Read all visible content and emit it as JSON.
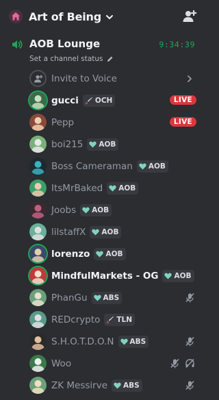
{
  "server": {
    "name": "Art of Being"
  },
  "channel": {
    "name": "AOB Lounge",
    "timer": "9:34:39",
    "status_placeholder": "Set a channel status"
  },
  "invite": {
    "label": "Invite to Voice"
  },
  "live_label": "LIVE",
  "members": [
    {
      "name": "gucci",
      "active": true,
      "tag": "OCH",
      "tag_icon": "sword-icon",
      "live": true,
      "avatar_bg": "#3a6b4a",
      "avatar_fg": "#c8e0c0"
    },
    {
      "name": "Pepp",
      "active": false,
      "tag": "",
      "tag_icon": "",
      "live": true,
      "avatar_bg": "#8a4a3a",
      "avatar_fg": "#f0d0b0"
    },
    {
      "name": "boi215",
      "active": false,
      "tag": "AOB",
      "tag_icon": "heart-icon",
      "live": false,
      "avatar_bg": "#7ab07a",
      "avatar_fg": "#e8e8e8"
    },
    {
      "name": "Boss Cameraman",
      "active": false,
      "tag": "AOB",
      "tag_icon": "heart-icon",
      "live": false,
      "avatar_bg": "#1c2a30",
      "avatar_fg": "#3ab0c0"
    },
    {
      "name": "ItsMrBaked",
      "active": false,
      "tag": "AOB",
      "tag_icon": "heart-icon",
      "live": false,
      "avatar_bg": "#3aa06a",
      "avatar_fg": "#f0c8b0"
    },
    {
      "name": "Joobs",
      "active": false,
      "tag": "AOB",
      "tag_icon": "heart-icon",
      "live": false,
      "avatar_bg": "#3a2a30",
      "avatar_fg": "#c06080"
    },
    {
      "name": "lilstaffX",
      "active": false,
      "tag": "AOB",
      "tag_icon": "heart-icon",
      "live": false,
      "avatar_bg": "#6ab09a",
      "avatar_fg": "#e0e0e0"
    },
    {
      "name": "lorenzo",
      "active": true,
      "tag": "AOB",
      "tag_icon": "heart-icon",
      "live": false,
      "avatar_bg": "#3a4a6a",
      "avatar_fg": "#e0d0b0"
    },
    {
      "name": "MindfulMarkets - OG",
      "active": true,
      "tag": "AOB",
      "tag_icon": "heart-icon",
      "live": false,
      "avatar_bg": "#c03a3a",
      "avatar_fg": "#f0e0d0"
    },
    {
      "name": "PhanGu",
      "active": false,
      "tag": "ABS",
      "tag_icon": "heart-icon",
      "live": false,
      "avatar_bg": "#6aa07a",
      "avatar_fg": "#e8e0d0",
      "mic_off": true
    },
    {
      "name": "REDcrypto",
      "active": false,
      "tag": "TLN",
      "tag_icon": "sword-icon",
      "live": false,
      "avatar_bg": "#5a9a8a",
      "avatar_fg": "#e0e0e0"
    },
    {
      "name": "S.H.O.T.D.O.N",
      "active": false,
      "tag": "ABS",
      "tag_icon": "heart-icon",
      "live": false,
      "avatar_bg": "#2a2a2a",
      "avatar_fg": "#e0c0a0",
      "mic_off": true
    },
    {
      "name": "Woo",
      "active": false,
      "tag": "",
      "tag_icon": "",
      "live": false,
      "avatar_bg": "#3a7a4a",
      "avatar_fg": "#f0f0f0",
      "mic_off": true,
      "deaf": true
    },
    {
      "name": "ZK Messirve",
      "active": false,
      "tag": "ABS",
      "tag_icon": "heart-icon",
      "live": false,
      "avatar_bg": "#6aa07a",
      "avatar_fg": "#f0e0c0",
      "mic_off": true
    }
  ],
  "icons": {
    "server": "home-icon",
    "header_action": "add-member-icon",
    "channel": "speaker-icon",
    "status_edit": "pencil-icon",
    "invite": "add-user-icon",
    "invite_arrow": "chevron-right-icon",
    "mic_off": "mic-off-icon",
    "deafened": "headphones-off-icon"
  },
  "colors": {
    "accent": "#23a55a",
    "live": "#da373c",
    "bg": "#2b2d31",
    "tag_heart": "#7fd3c0"
  }
}
